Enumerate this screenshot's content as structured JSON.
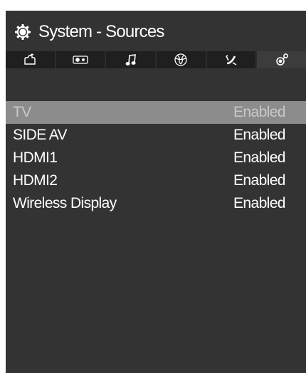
{
  "header": {
    "title": "System - Sources",
    "icon": "gear-icon"
  },
  "tabs": [
    {
      "icon": "picture-icon",
      "active": false
    },
    {
      "icon": "sound-system-icon",
      "active": false
    },
    {
      "icon": "music-note-icon",
      "active": false
    },
    {
      "icon": "network-globe-icon",
      "active": false
    },
    {
      "icon": "satellite-dish-icon",
      "active": false
    },
    {
      "icon": "settings-icon",
      "active": true
    }
  ],
  "sources": [
    {
      "label": "TV",
      "status": "Enabled",
      "selected": true
    },
    {
      "label": "SIDE AV",
      "status": "Enabled",
      "selected": false
    },
    {
      "label": "HDMI1",
      "status": "Enabled",
      "selected": false
    },
    {
      "label": "HDMI2",
      "status": "Enabled",
      "selected": false
    },
    {
      "label": "Wireless Display",
      "status": "Enabled",
      "selected": false
    }
  ],
  "colors": {
    "panel": "#333333",
    "tab": "#1f1f1f",
    "selected_row": "#8c8c8c"
  }
}
